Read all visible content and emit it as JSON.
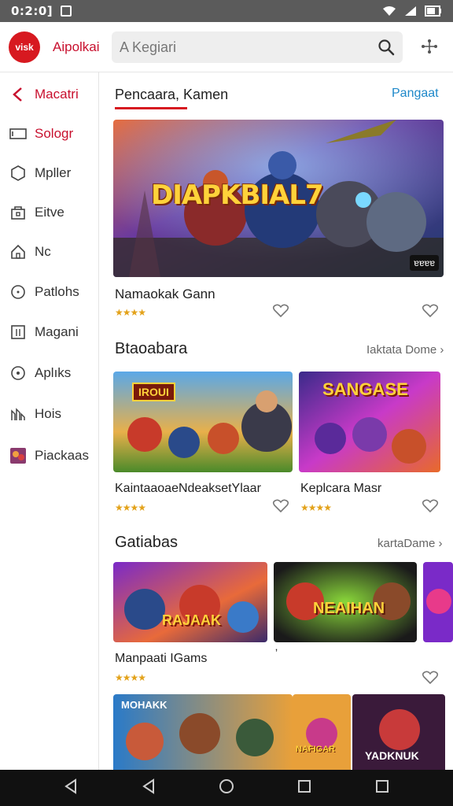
{
  "status_bar": {
    "time": "0:2:0]"
  },
  "header": {
    "logo_text": "visk",
    "app_name": "Aipolkai",
    "search_placeholder": "A Kegiari"
  },
  "sidebar": {
    "items": [
      {
        "label": "Macatri",
        "icon": "back-chevron-icon",
        "active": true
      },
      {
        "label": "Sologr",
        "icon": "screen-icon",
        "active": true
      },
      {
        "label": "Mpller",
        "icon": "hexagon-icon",
        "active": false
      },
      {
        "label": "Eitve",
        "icon": "bag-icon",
        "active": false
      },
      {
        "label": "Nc",
        "icon": "home-icon",
        "active": false
      },
      {
        "label": "Patlohs",
        "icon": "clock-icon",
        "active": false
      },
      {
        "label": "Magani",
        "icon": "grid-icon",
        "active": false
      },
      {
        "label": "Aplıks",
        "icon": "circle-dot-icon",
        "active": false
      },
      {
        "label": "Hois",
        "icon": "chart-icon",
        "active": false
      },
      {
        "label": "Piackaas",
        "icon": "game-thumb-icon",
        "active": false
      }
    ]
  },
  "main": {
    "top_section": {
      "title": "Pencaara, Kamen",
      "link": "Pangaat"
    },
    "featured": {
      "banner_text": "DIAPKBIAL7",
      "badge": "ɐɐɐɐ",
      "title": "Namaokak Gann",
      "rating": "★★★★"
    },
    "section2": {
      "title": "Btaoabara",
      "link": "Iaktata Dome ›",
      "cards": [
        {
          "banner_text": "IROUI",
          "title": "KaintaaoaeNdeaksetYlaar",
          "rating": "★★★★"
        },
        {
          "banner_text": "SANGASE",
          "title": "Keplcara Masr",
          "rating": "★★★★"
        }
      ]
    },
    "section3": {
      "title": "Gatiabas",
      "link": "kartaDame ›",
      "cards": [
        {
          "banner_text": "RAJAAK",
          "title": "Manpaati IGams",
          "rating": "★★★★"
        },
        {
          "banner_text": "NEAIHAN",
          "title": "ʼ",
          "rating": ""
        }
      ]
    },
    "section4": {
      "cards": [
        {
          "banner_text": "MOHAKK"
        },
        {
          "banner_text": "NAFIGAR"
        },
        {
          "banner_text": "YADKNUK"
        }
      ]
    }
  },
  "colors": {
    "accent": "#d71920",
    "link_blue": "#1e88c9",
    "star": "#e3a21a"
  }
}
